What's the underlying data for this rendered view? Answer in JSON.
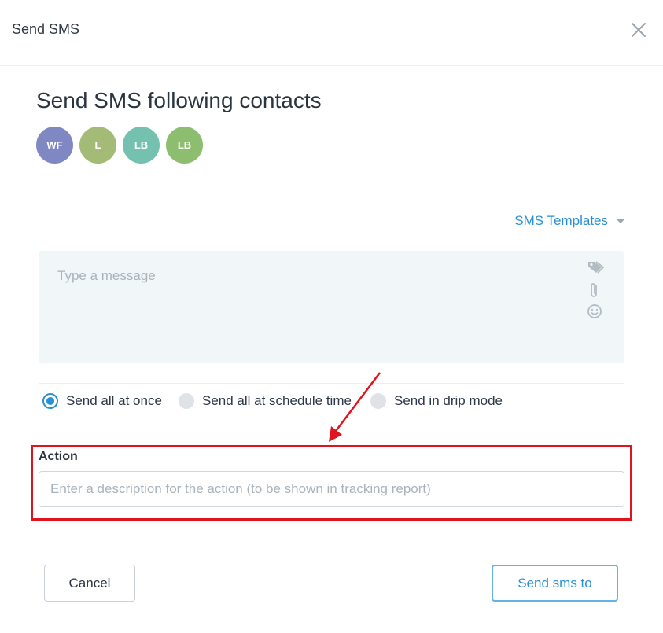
{
  "header": {
    "title": "Send SMS"
  },
  "main": {
    "title": "Send SMS following contacts",
    "contacts": [
      {
        "initials": "WF",
        "color": "#7f88c3"
      },
      {
        "initials": "L",
        "color": "#a3bb76"
      },
      {
        "initials": "LB",
        "color": "#74c1b0"
      },
      {
        "initials": "LB",
        "color": "#8dbd6f"
      }
    ],
    "templates_label": "SMS Templates",
    "message": {
      "placeholder": "Type a message",
      "value": ""
    },
    "send_options": [
      {
        "label": "Send all at once",
        "selected": true
      },
      {
        "label": "Send all at schedule time",
        "selected": false
      },
      {
        "label": "Send in drip mode",
        "selected": false
      }
    ],
    "action": {
      "label": "Action",
      "placeholder": "Enter a description for the action (to be shown in tracking report)",
      "value": ""
    }
  },
  "footer": {
    "cancel_label": "Cancel",
    "send_label": "Send sms to"
  },
  "colors": {
    "accent": "#2a8fd4",
    "highlight": "#e0141e"
  }
}
